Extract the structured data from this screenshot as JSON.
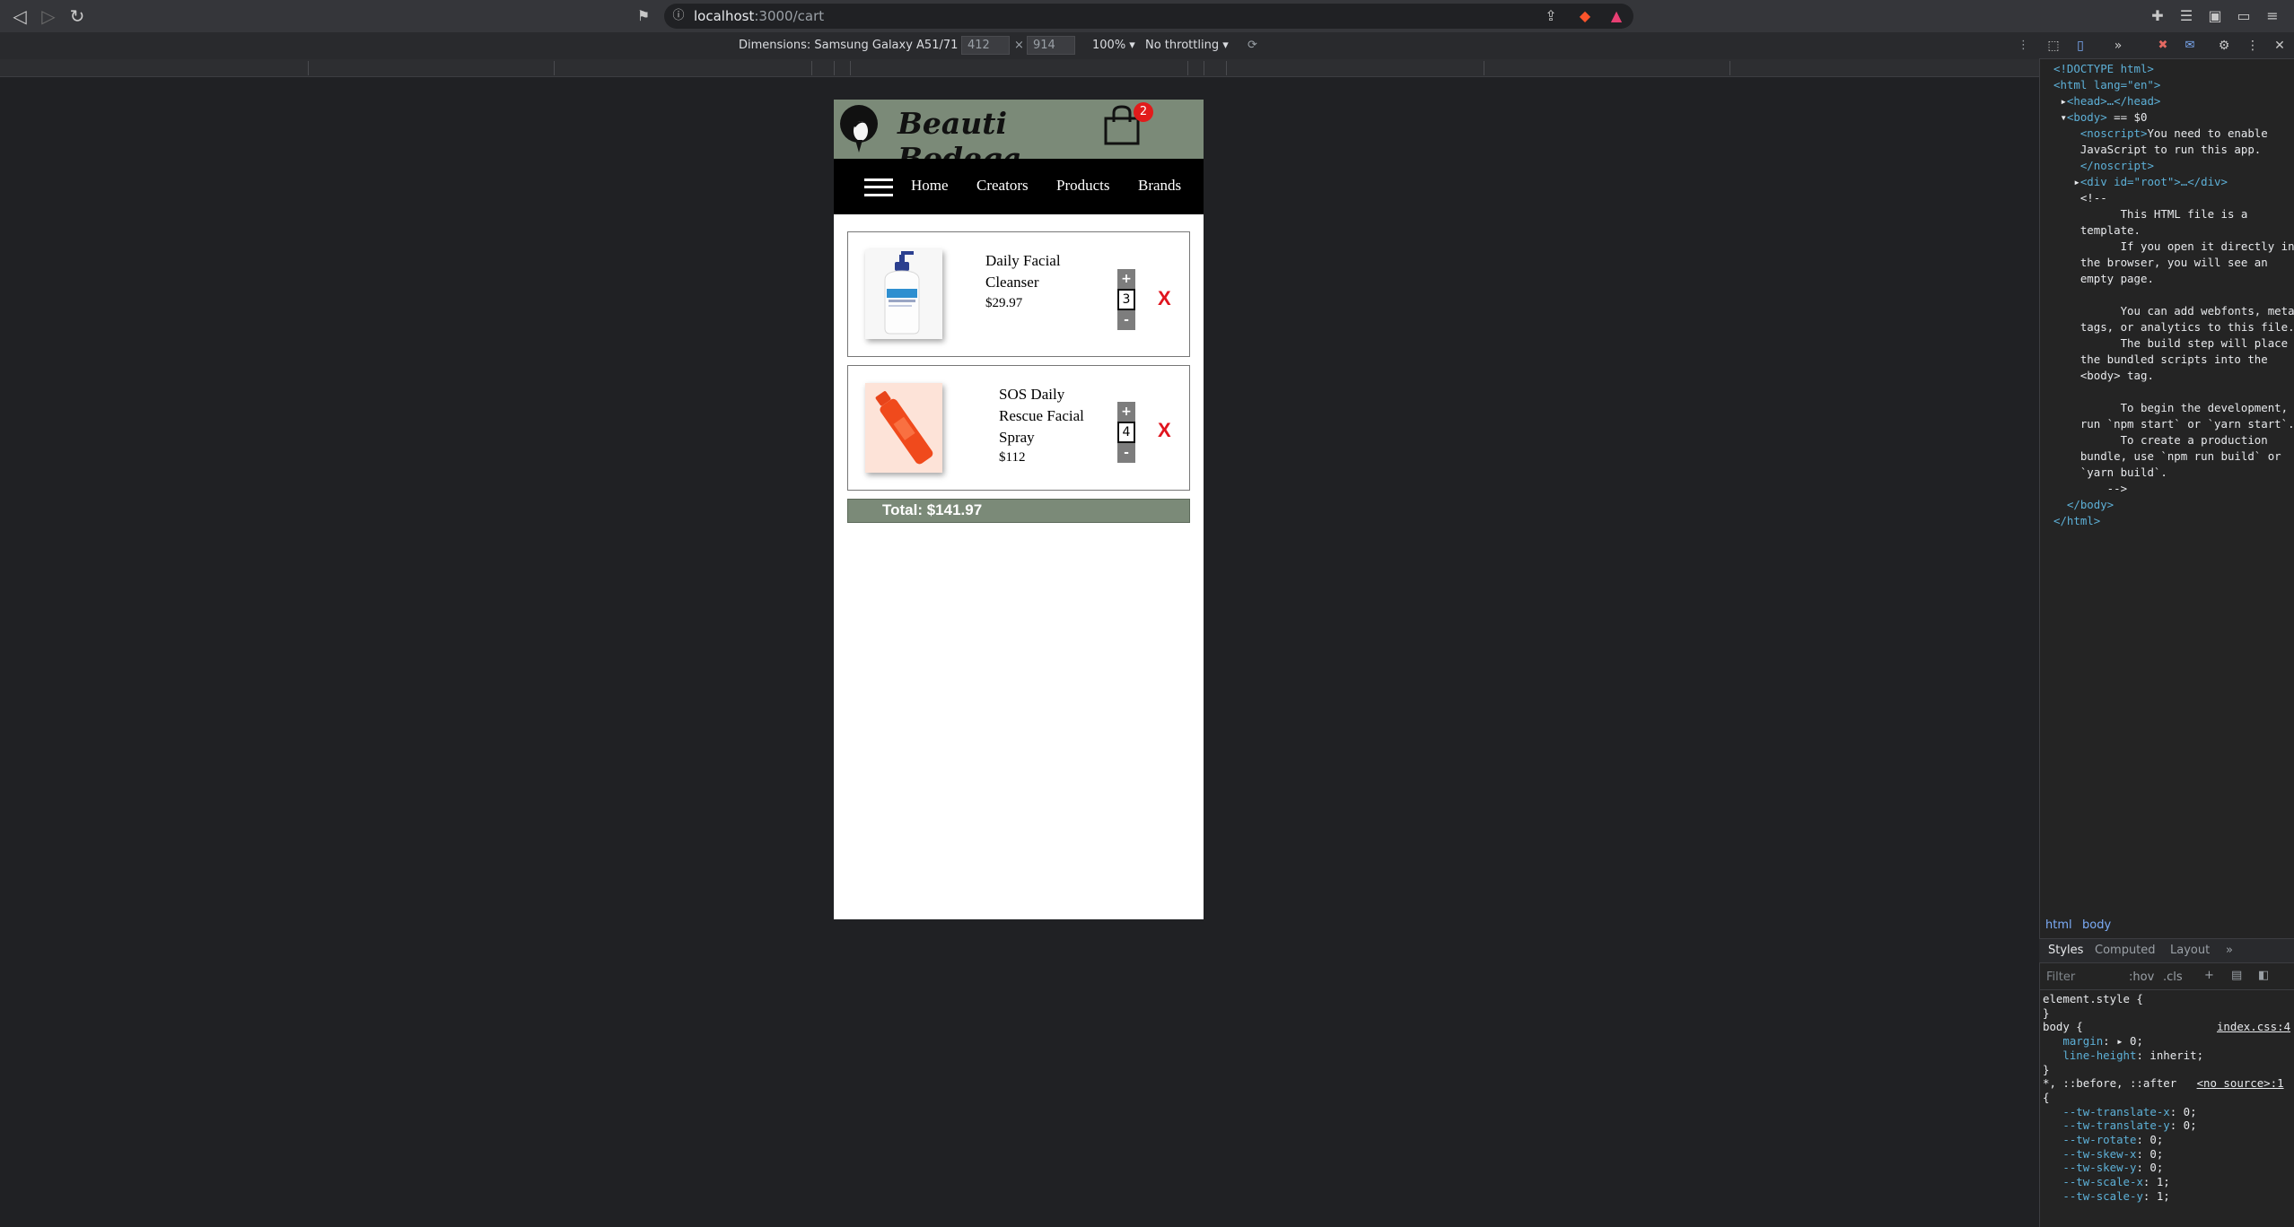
{
  "browser": {
    "url_host": "localhost",
    "url_path": ":3000/cart"
  },
  "device_toolbar": {
    "dimensions_label": "Dimensions: Samsung Galaxy A51/71",
    "width": "412",
    "times": "×",
    "height": "914",
    "zoom": "100%",
    "throttling": "No throttling"
  },
  "app": {
    "brand": "Beauti Bodega",
    "cart_count": "2",
    "menu": [
      "Home",
      "Creators",
      "Products",
      "Brands"
    ],
    "cart_items": [
      {
        "name_lines": [
          "Daily Facial",
          "Cleanser"
        ],
        "price": "$29.97",
        "quantity": "3",
        "remove": "X"
      },
      {
        "name_lines": [
          "SOS Daily",
          "Rescue Facial",
          "Spray"
        ],
        "price": "$112",
        "quantity": "4",
        "remove": "X"
      }
    ],
    "plus": "+",
    "minus": "-",
    "total": "Total: $141.97"
  },
  "devtools": {
    "crumbs": [
      "html",
      "body"
    ],
    "tabs": [
      "Styles",
      "Computed",
      "Layout"
    ],
    "filter_placeholder": "Filter",
    "hov": ":hov",
    "cls": ".cls"
  },
  "colors": {
    "header_bg": "#7b8a78",
    "menu_bg": "#000000",
    "badge": "#e21b1b",
    "remove": "#e0141e"
  }
}
